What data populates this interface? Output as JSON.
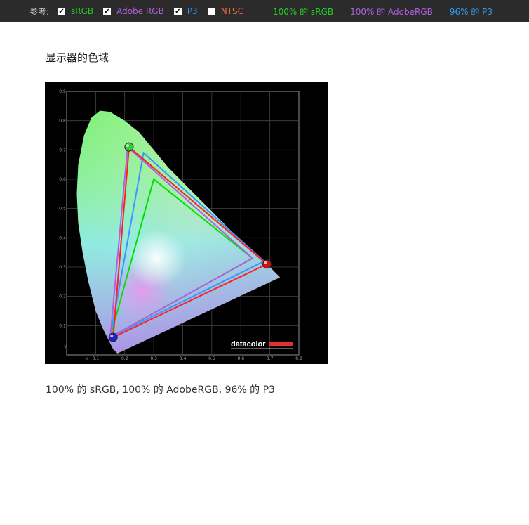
{
  "toolbar": {
    "reference_label": "参考:",
    "checkboxes": [
      {
        "label": "sRGB",
        "checked": true,
        "color": "#22cc22"
      },
      {
        "label": "Adobe RGB",
        "checked": true,
        "color": "#b060e0"
      },
      {
        "label": "P3",
        "checked": true,
        "color": "#3399ee"
      },
      {
        "label": "NTSC",
        "checked": false,
        "color": "#ff6a3d"
      }
    ],
    "coverage": [
      {
        "text": "100% 的 sRGB",
        "color": "#22cc22"
      },
      {
        "text": "100% 的 AdobeRGB",
        "color": "#b060e0"
      },
      {
        "text": "96% 的 P3",
        "color": "#3399ee"
      }
    ]
  },
  "section": {
    "title": "显示器的色域",
    "caption": "100% 的 sRGB, 100% 的 AdobeRGB, 96% 的 P3"
  },
  "chart_data": {
    "type": "scatter",
    "watermark": "datacolor",
    "xlabel": "x",
    "ylabel": "y",
    "xlim": [
      0,
      0.8
    ],
    "ylim": [
      0,
      0.9
    ],
    "x_ticks": [
      "0.1",
      "0.2",
      "0.3",
      "0.4",
      "0.5",
      "0.6",
      "0.7",
      "0.8"
    ],
    "y_ticks": [
      "0.1",
      "0.2",
      "0.3",
      "0.4",
      "0.5",
      "0.6",
      "0.7",
      "0.8",
      "0.9"
    ],
    "grid": true,
    "series": [
      {
        "color": "#00e000",
        "points": [
          [
            0.64,
            0.33
          ],
          [
            0.3,
            0.6
          ],
          [
            0.15,
            0.06
          ]
        ]
      },
      {
        "color": "#3399ff",
        "points": [
          [
            0.68,
            0.32
          ],
          [
            0.265,
            0.69
          ],
          [
            0.15,
            0.06
          ]
        ]
      },
      {
        "color": "#b060e0",
        "points": [
          [
            0.64,
            0.33
          ],
          [
            0.21,
            0.71
          ],
          [
            0.15,
            0.06
          ]
        ]
      },
      {
        "color": "#ff2020",
        "points": [
          [
            0.69,
            0.31
          ],
          [
            0.215,
            0.71
          ],
          [
            0.16,
            0.06
          ]
        ]
      }
    ],
    "markers": [
      {
        "x": 0.215,
        "y": 0.71,
        "color": "#33cc33"
      },
      {
        "x": 0.69,
        "y": 0.31,
        "color": "#cc1111"
      },
      {
        "x": 0.16,
        "y": 0.06,
        "color": "#2222cc"
      }
    ]
  }
}
